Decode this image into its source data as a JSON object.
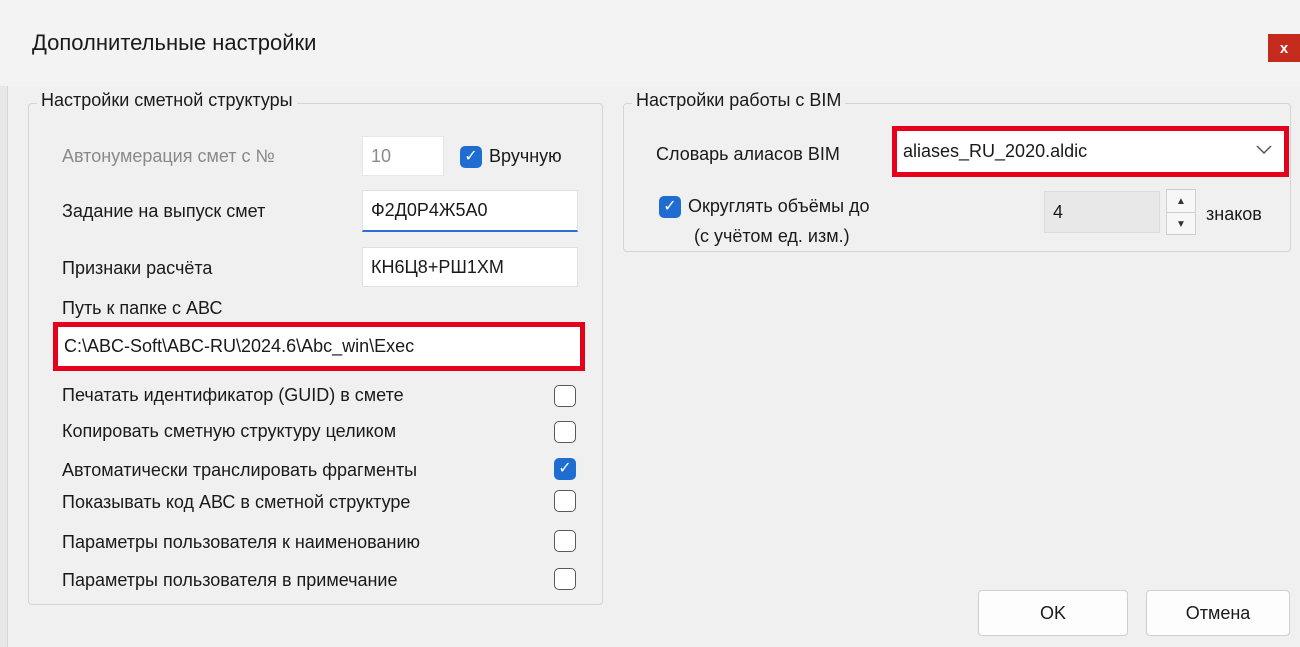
{
  "window": {
    "title": "Дополнительные настройки",
    "close_glyph": "x"
  },
  "estimate_group": {
    "title": "Настройки сметной структуры",
    "autonumber_label": "Автонумерация смет с №",
    "autonumber_value": "10",
    "manual_label": "Вручную",
    "manual_checked": true,
    "task_label": "Задание на выпуск смет",
    "task_value": "Ф2Д0Р4Ж5А0",
    "calc_label": "Признаки расчёта",
    "calc_value": "КН6Ц8+РШ1ХМ",
    "path_label": "Путь к папке с АВС",
    "path_value": "C:\\ABC-Soft\\ABC-RU\\2024.6\\Abc_win\\Exec",
    "options": [
      {
        "label": "Печатать идентификатор (GUID) в смете",
        "checked": false
      },
      {
        "label": "Копировать сметную структуру целиком",
        "checked": false
      },
      {
        "label": "Автоматически транслировать фрагменты",
        "checked": true
      },
      {
        "label": "Показывать код АВС в сметной структуре",
        "checked": false
      },
      {
        "label": "Параметры пользователя к наименованию",
        "checked": false
      },
      {
        "label": "Параметры пользователя в примечание",
        "checked": false
      }
    ]
  },
  "bim_group": {
    "title": "Настройки работы с BIM",
    "dict_label": "Словарь алиасов BIM",
    "dict_value": "aliases_RU_2020.aldic",
    "round_label_line1": "Округлять объёмы до",
    "round_label_line2": "(с учётом ед. изм.)",
    "round_checked": true,
    "round_value": "4",
    "round_unit": "знаков"
  },
  "buttons": {
    "ok": "OK",
    "cancel": "Отмена"
  },
  "colors": {
    "accent": "#1f6dd1",
    "highlight": "#e6001b",
    "close": "#c42b1c"
  }
}
